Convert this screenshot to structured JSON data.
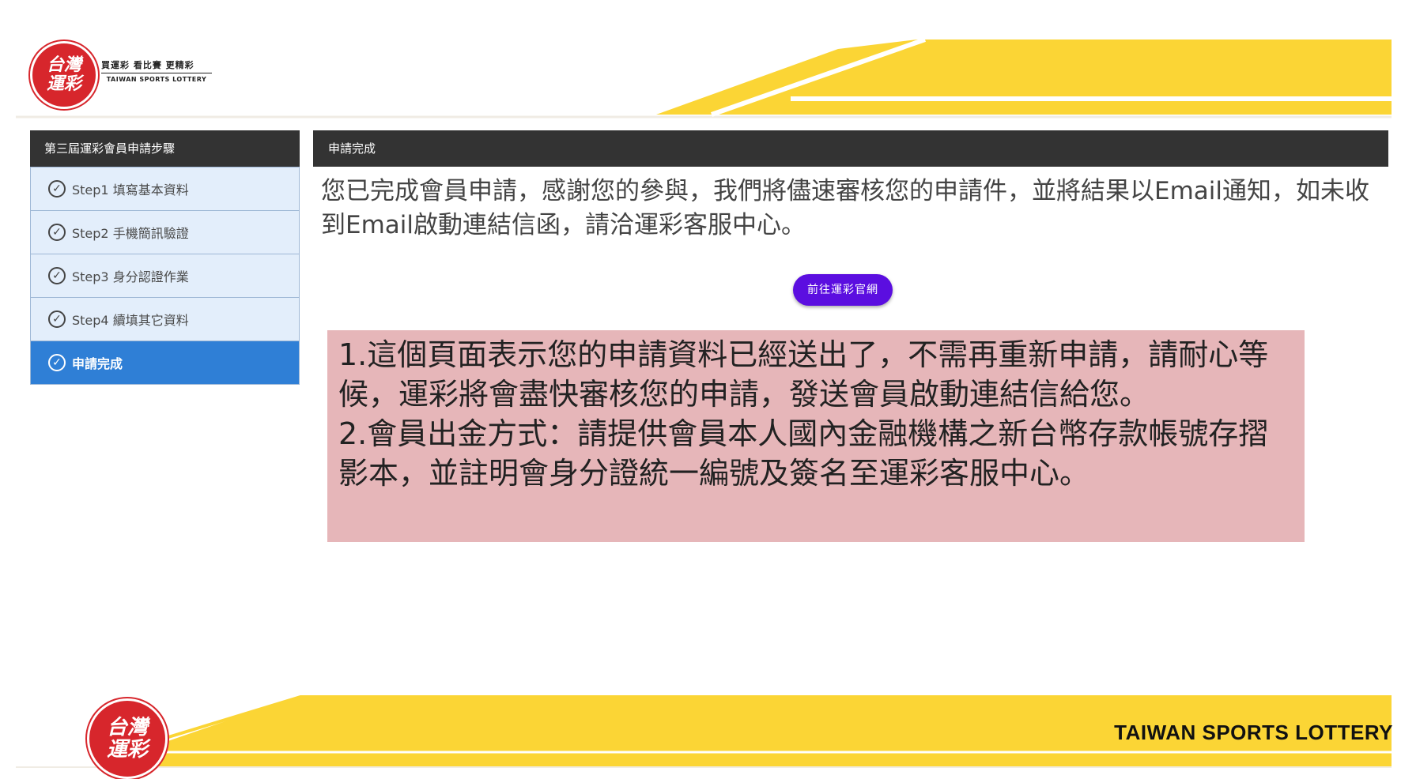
{
  "header": {
    "logo_line1": "台灣",
    "logo_line2": "運彩",
    "slogan": "買運彩 看比賽 更精彩",
    "logo_en": "TAIWAN SPORTS LOTTERY",
    "accent_color": "#fbd535"
  },
  "sidebar": {
    "title": "第三屆運彩會員申請步驟",
    "steps": [
      {
        "label": "Step1 填寫基本資料",
        "state": "done"
      },
      {
        "label": "Step2 手機簡訊驗證",
        "state": "done"
      },
      {
        "label": "Step3 身分認證作業",
        "state": "done"
      },
      {
        "label": "Step4 續填其它資料",
        "state": "done"
      },
      {
        "label": "申請完成",
        "state": "active"
      }
    ]
  },
  "main": {
    "title": "申請完成",
    "message": "您已完成會員申請，感謝您的參與，我們將儘速審核您的申請件，並將結果以Email通知，如未收到Email啟動連結信函，請洽運彩客服中心。",
    "button_label": "前往運彩官網",
    "button_color": "#5b0ee0"
  },
  "note": {
    "line1": "1.這個頁面表示您的申請資料已經送出了，不需再重新申請，請耐心等候，運彩將會盡快審核您的申請，發送會員啟動連結信給您。",
    "line2": "2.會員出金方式：請提供會員本人國內金融機構之新台幣存款帳號存摺影本，並註明會身分證統一編號及簽名至運彩客服中心。",
    "background_color": "#e6b6b9"
  },
  "footer": {
    "logo_line1": "台灣",
    "logo_line2": "運彩",
    "brand": "TAIWAN SPORTS LOTTERY"
  },
  "icons": {
    "step_check": "check-circle-icon"
  }
}
